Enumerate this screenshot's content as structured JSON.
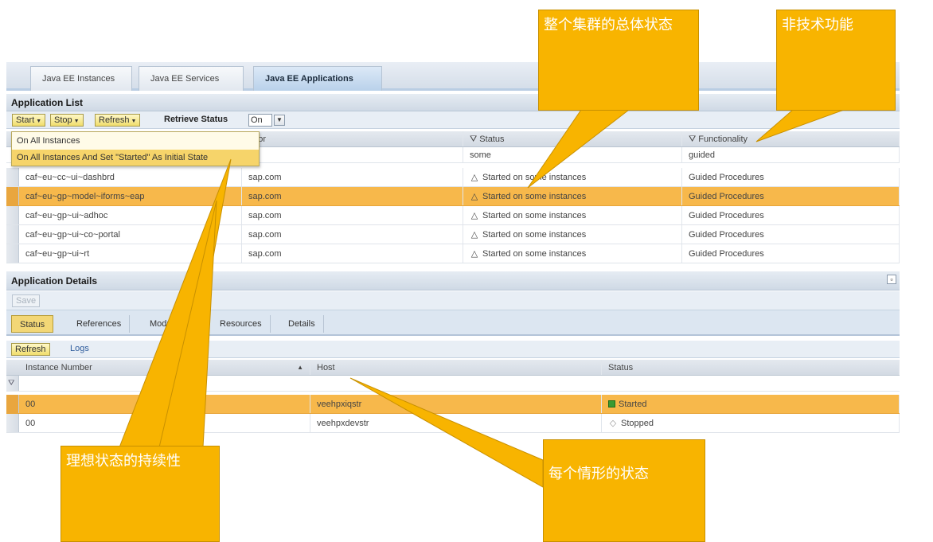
{
  "top_tabs": [
    "Java EE Instances",
    "Java EE Services",
    "Java EE Applications"
  ],
  "application_list": {
    "title": "Application List",
    "toolbar": {
      "start": "Start",
      "stop": "Stop",
      "refresh": "Refresh",
      "retrieve_status_label": "Retrieve Status",
      "retrieve_status_value": "On"
    },
    "start_menu": [
      "On All Instances",
      "On All Instances And Set \"Started\" As Initial State"
    ],
    "columns": [
      "ndor",
      "Status",
      "Functionality"
    ],
    "filter_row": [
      "",
      "some",
      "guided"
    ],
    "rows": [
      [
        "caf~eu~cc~ui~dashbrd",
        "sap.com",
        "Started on some instances",
        "Guided Procedures"
      ],
      [
        "caf~eu~gp~model~iforms~eap",
        "sap.com",
        "Started on some instances",
        "Guided Procedures"
      ],
      [
        "caf~eu~gp~ui~adhoc",
        "sap.com",
        "Started on some instances",
        "Guided Procedures"
      ],
      [
        "caf~eu~gp~ui~co~portal",
        "sap.com",
        "Started on some instances",
        "Guided Procedures"
      ],
      [
        "caf~eu~gp~ui~rt",
        "sap.com",
        "Started on some instances",
        "Guided Procedures"
      ]
    ]
  },
  "application_details": {
    "title": "Application Details",
    "save": "Save",
    "tabs": [
      "Status",
      "References",
      "Module",
      "Resources",
      "Details"
    ],
    "refresh": "Refresh",
    "logs": "Logs",
    "columns": [
      "Instance Number",
      "Host",
      "Status"
    ],
    "rows": [
      [
        "00",
        "veehpxiqstr",
        "Started"
      ],
      [
        "00",
        "veehpxdevstr",
        "Stopped"
      ]
    ]
  },
  "callouts": {
    "overall_status": "整个集群的总体状态",
    "non_technical": "非技术功能",
    "persistence": "理想状态的持续性",
    "each_status": "每个情形的状态"
  },
  "colors": {
    "callout": "#f8b400",
    "selected_row": "#f7b84b",
    "header": "#cfd9e5"
  }
}
